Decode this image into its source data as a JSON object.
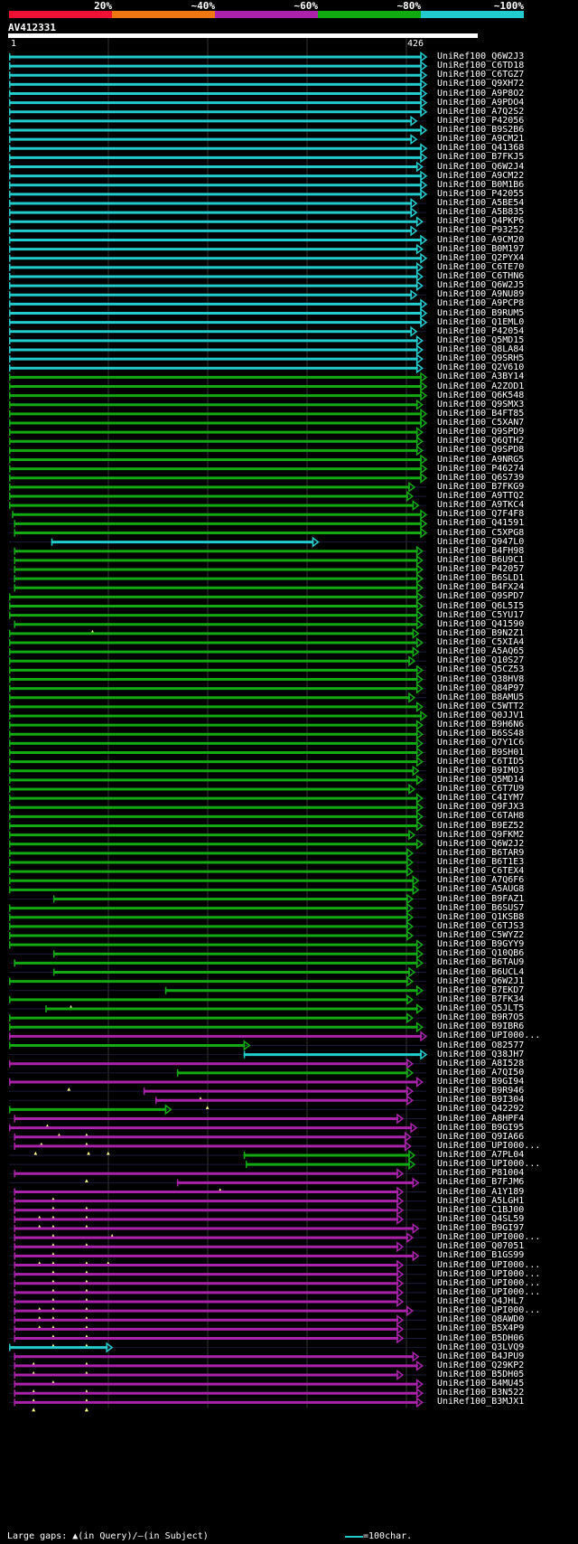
{
  "query_id": "AV412331",
  "ruler": {
    "start": "1",
    "end": "426"
  },
  "scale": {
    "labels": [
      "20%",
      "~40%",
      "~60%",
      "~80%",
      "~100%"
    ],
    "colors": [
      "#ee1133",
      "#ee7711",
      "#aa22aa",
      "#11aa11",
      "#22cccc"
    ]
  },
  "footer": {
    "gaps_text": "Large gaps: ▲(in Query)/—(in Subject)",
    "scale_text": "=100char."
  },
  "chart_data": {
    "type": "alignment",
    "query_length": 426,
    "hits": [
      {
        "id": "UniRef100_Q6W2J3",
        "start": 1,
        "end": 426,
        "color": "#22cccc"
      },
      {
        "id": "UniRef100_C6TD18",
        "start": 1,
        "end": 426,
        "color": "#22cccc"
      },
      {
        "id": "UniRef100_C6TGZ7",
        "start": 1,
        "end": 426,
        "color": "#22cccc"
      },
      {
        "id": "UniRef100_Q9XH72",
        "start": 1,
        "end": 426,
        "color": "#22cccc"
      },
      {
        "id": "UniRef100_A9P8O2",
        "start": 1,
        "end": 426,
        "color": "#22cccc"
      },
      {
        "id": "UniRef100_A9PDO4",
        "start": 1,
        "end": 426,
        "color": "#22cccc"
      },
      {
        "id": "UniRef100_A7Q2S2",
        "start": 1,
        "end": 426,
        "color": "#22cccc"
      },
      {
        "id": "UniRef100_P42056",
        "start": 1,
        "end": 416,
        "color": "#22cccc"
      },
      {
        "id": "UniRef100_B9S2B6",
        "start": 1,
        "end": 426,
        "color": "#22cccc"
      },
      {
        "id": "UniRef100_A9CM21",
        "start": 1,
        "end": 416,
        "color": "#22cccc"
      },
      {
        "id": "UniRef100_Q41368",
        "start": 1,
        "end": 426,
        "color": "#22cccc"
      },
      {
        "id": "UniRef100_B7FKJ5",
        "start": 1,
        "end": 426,
        "color": "#22cccc"
      },
      {
        "id": "UniRef100_Q6W2J4",
        "start": 1,
        "end": 422,
        "color": "#22cccc"
      },
      {
        "id": "UniRef100_A9CM22",
        "start": 1,
        "end": 426,
        "color": "#22cccc"
      },
      {
        "id": "UniRef100_B0M1B6",
        "start": 1,
        "end": 426,
        "color": "#22cccc"
      },
      {
        "id": "UniRef100_P42055",
        "start": 1,
        "end": 426,
        "color": "#22cccc"
      },
      {
        "id": "UniRef100_A5BE54",
        "start": 1,
        "end": 416,
        "color": "#22cccc"
      },
      {
        "id": "UniRef100_A5B835",
        "start": 1,
        "end": 416,
        "color": "#22cccc"
      },
      {
        "id": "UniRef100_Q4PKP6",
        "start": 1,
        "end": 422,
        "color": "#22cccc"
      },
      {
        "id": "UniRef100_P93252",
        "start": 1,
        "end": 416,
        "color": "#22cccc"
      },
      {
        "id": "UniRef100_A9CM20",
        "start": 1,
        "end": 426,
        "color": "#22cccc"
      },
      {
        "id": "UniRef100_B0M197",
        "start": 1,
        "end": 422,
        "color": "#22cccc"
      },
      {
        "id": "UniRef100_Q2PYX4",
        "start": 1,
        "end": 426,
        "color": "#22cccc"
      },
      {
        "id": "UniRef100_C6TE70",
        "start": 1,
        "end": 422,
        "color": "#22cccc"
      },
      {
        "id": "UniRef100_C6THN6",
        "start": 1,
        "end": 422,
        "color": "#22cccc"
      },
      {
        "id": "UniRef100_Q6W2J5",
        "start": 1,
        "end": 422,
        "color": "#22cccc"
      },
      {
        "id": "UniRef100_A9NU89",
        "start": 1,
        "end": 416,
        "color": "#22cccc"
      },
      {
        "id": "UniRef100_A9PCP8",
        "start": 1,
        "end": 426,
        "color": "#22cccc"
      },
      {
        "id": "UniRef100_B9RUM5",
        "start": 1,
        "end": 426,
        "color": "#22cccc"
      },
      {
        "id": "UniRef100_Q1EML0",
        "start": 1,
        "end": 426,
        "color": "#22cccc"
      },
      {
        "id": "UniRef100_P42054",
        "start": 1,
        "end": 416,
        "color": "#22cccc"
      },
      {
        "id": "UniRef100_Q5MD15",
        "start": 1,
        "end": 422,
        "color": "#22cccc"
      },
      {
        "id": "UniRef100_Q8LA84",
        "start": 1,
        "end": 422,
        "color": "#22cccc"
      },
      {
        "id": "UniRef100_Q9SRH5",
        "start": 1,
        "end": 422,
        "color": "#22cccc"
      },
      {
        "id": "UniRef100_Q2V610",
        "start": 1,
        "end": 422,
        "color": "#22cccc"
      },
      {
        "id": "UniRef100_A3BY14",
        "start": 1,
        "end": 426,
        "color": "#11aa11"
      },
      {
        "id": "UniRef100_A2ZOD1",
        "start": 1,
        "end": 426,
        "color": "#11aa11"
      },
      {
        "id": "UniRef100_Q6K548",
        "start": 1,
        "end": 426,
        "color": "#11aa11"
      },
      {
        "id": "UniRef100_Q9SMX3",
        "start": 1,
        "end": 422,
        "color": "#11aa11"
      },
      {
        "id": "UniRef100_B4FT85",
        "start": 1,
        "end": 426,
        "color": "#11aa11"
      },
      {
        "id": "UniRef100_C5XAN7",
        "start": 1,
        "end": 426,
        "color": "#11aa11"
      },
      {
        "id": "UniRef100_Q9SPD9",
        "start": 1,
        "end": 422,
        "color": "#11aa11"
      },
      {
        "id": "UniRef100_Q6QTH2",
        "start": 1,
        "end": 422,
        "color": "#11aa11"
      },
      {
        "id": "UniRef100_Q9SPD8",
        "start": 1,
        "end": 422,
        "color": "#11aa11"
      },
      {
        "id": "UniRef100_A9NRG5",
        "start": 1,
        "end": 426,
        "color": "#11aa11"
      },
      {
        "id": "UniRef100_P46274",
        "start": 1,
        "end": 426,
        "color": "#11aa11"
      },
      {
        "id": "UniRef100_Q6S739",
        "start": 1,
        "end": 426,
        "color": "#11aa11"
      },
      {
        "id": "UniRef100_B7FKG9",
        "start": 1,
        "end": 414,
        "color": "#11aa11"
      },
      {
        "id": "UniRef100_A9TTQ2",
        "start": 1,
        "end": 412,
        "color": "#11aa11"
      },
      {
        "id": "UniRef100_A9TKC4",
        "start": 1,
        "end": 418,
        "color": "#11aa11"
      },
      {
        "id": "UniRef100_Q7F4F8",
        "start": 4,
        "end": 426,
        "color": "#11aa11"
      },
      {
        "id": "UniRef100_Q41591",
        "start": 6,
        "end": 426,
        "color": "#11aa11"
      },
      {
        "id": "UniRef100_C5XPG8",
        "start": 6,
        "end": 426,
        "color": "#11aa11"
      },
      {
        "id": "UniRef100_Q947L0",
        "start": 44,
        "end": 316,
        "color": "#22cccc"
      },
      {
        "id": "UniRef100_B4FH98",
        "start": 6,
        "end": 422,
        "color": "#11aa11"
      },
      {
        "id": "UniRef100_B6U9C1",
        "start": 6,
        "end": 422,
        "color": "#11aa11"
      },
      {
        "id": "UniRef100_P42057",
        "start": 6,
        "end": 422,
        "color": "#11aa11"
      },
      {
        "id": "UniRef100_B6SLD1",
        "start": 6,
        "end": 422,
        "color": "#11aa11"
      },
      {
        "id": "UniRef100_B4FX24",
        "start": 6,
        "end": 422,
        "color": "#11aa11"
      },
      {
        "id": "UniRef100_Q9SPD7",
        "start": 1,
        "end": 422,
        "color": "#11aa11"
      },
      {
        "id": "UniRef100_Q6L5I5",
        "start": 1,
        "end": 422,
        "color": "#11aa11"
      },
      {
        "id": "UniRef100_C5YU17",
        "start": 1,
        "end": 422,
        "color": "#11aa11"
      },
      {
        "id": "UniRef100_Q41590",
        "start": 6,
        "end": 422,
        "color": "#11aa11",
        "gaps": [
          86
        ]
      },
      {
        "id": "UniRef100_B9N2Z1",
        "start": 1,
        "end": 418,
        "color": "#11aa11"
      },
      {
        "id": "UniRef100_C5XIA4",
        "start": 1,
        "end": 422,
        "color": "#11aa11"
      },
      {
        "id": "UniRef100_A5AQ65",
        "start": 1,
        "end": 418,
        "color": "#11aa11"
      },
      {
        "id": "UniRef100_Q10S27",
        "start": 1,
        "end": 414,
        "color": "#11aa11"
      },
      {
        "id": "UniRef100_Q5CZ53",
        "start": 1,
        "end": 422,
        "color": "#11aa11"
      },
      {
        "id": "UniRef100_Q38HV8",
        "start": 1,
        "end": 422,
        "color": "#11aa11"
      },
      {
        "id": "UniRef100_Q84P97",
        "start": 1,
        "end": 422,
        "color": "#11aa11"
      },
      {
        "id": "UniRef100_B8AMU5",
        "start": 1,
        "end": 414,
        "color": "#11aa11"
      },
      {
        "id": "UniRef100_C5WTT2",
        "start": 1,
        "end": 422,
        "color": "#11aa11"
      },
      {
        "id": "UniRef100_Q0JJV1",
        "start": 1,
        "end": 426,
        "color": "#11aa11"
      },
      {
        "id": "UniRef100_B9H6N6",
        "start": 1,
        "end": 422,
        "color": "#11aa11"
      },
      {
        "id": "UniRef100_B6SS48",
        "start": 1,
        "end": 422,
        "color": "#11aa11"
      },
      {
        "id": "UniRef100_Q7Y1C6",
        "start": 1,
        "end": 422,
        "color": "#11aa11"
      },
      {
        "id": "UniRef100_B9SH01",
        "start": 1,
        "end": 422,
        "color": "#11aa11"
      },
      {
        "id": "UniRef100_C6TID5",
        "start": 1,
        "end": 422,
        "color": "#11aa11"
      },
      {
        "id": "UniRef100_B9IMO3",
        "start": 1,
        "end": 418,
        "color": "#11aa11"
      },
      {
        "id": "UniRef100_Q5MD14",
        "start": 1,
        "end": 422,
        "color": "#11aa11"
      },
      {
        "id": "UniRef100_C6T7U9",
        "start": 1,
        "end": 414,
        "color": "#11aa11"
      },
      {
        "id": "UniRef100_C4IYM7",
        "start": 1,
        "end": 422,
        "color": "#11aa11"
      },
      {
        "id": "UniRef100_Q9FJX3",
        "start": 1,
        "end": 422,
        "color": "#11aa11"
      },
      {
        "id": "UniRef100_C6TAH8",
        "start": 1,
        "end": 422,
        "color": "#11aa11"
      },
      {
        "id": "UniRef100_B9EZ52",
        "start": 1,
        "end": 422,
        "color": "#11aa11"
      },
      {
        "id": "UniRef100_Q9FKM2",
        "start": 1,
        "end": 414,
        "color": "#11aa11"
      },
      {
        "id": "UniRef100_Q6W2J2",
        "start": 1,
        "end": 422,
        "color": "#11aa11"
      },
      {
        "id": "UniRef100_B6TAR9",
        "start": 1,
        "end": 412,
        "color": "#11aa11"
      },
      {
        "id": "UniRef100_B6T1E3",
        "start": 1,
        "end": 412,
        "color": "#11aa11"
      },
      {
        "id": "UniRef100_C6TEX4",
        "start": 1,
        "end": 412,
        "color": "#11aa11"
      },
      {
        "id": "UniRef100_A7Q6F6",
        "start": 1,
        "end": 418,
        "color": "#11aa11"
      },
      {
        "id": "UniRef100_A5AUG8",
        "start": 1,
        "end": 418,
        "color": "#11aa11"
      },
      {
        "id": "UniRef100_B9FAZ1",
        "start": 46,
        "end": 412,
        "color": "#11aa11"
      },
      {
        "id": "UniRef100_B6SUS7",
        "start": 1,
        "end": 412,
        "color": "#11aa11"
      },
      {
        "id": "UniRef100_Q1KSB8",
        "start": 1,
        "end": 412,
        "color": "#11aa11"
      },
      {
        "id": "UniRef100_C6TJS3",
        "start": 1,
        "end": 412,
        "color": "#11aa11"
      },
      {
        "id": "UniRef100_C5WYZ2",
        "start": 1,
        "end": 412,
        "color": "#11aa11"
      },
      {
        "id": "UniRef100_B9GYY9",
        "start": 1,
        "end": 422,
        "color": "#11aa11"
      },
      {
        "id": "UniRef100_Q10QB6",
        "start": 46,
        "end": 422,
        "color": "#11aa11"
      },
      {
        "id": "UniRef100_B6TAU9",
        "start": 6,
        "end": 422,
        "color": "#11aa11"
      },
      {
        "id": "UniRef100_B6UCL4",
        "start": 46,
        "end": 414,
        "color": "#11aa11"
      },
      {
        "id": "UniRef100_Q6W2J1",
        "start": 1,
        "end": 412,
        "color": "#11aa11"
      },
      {
        "id": "UniRef100_B7EKD7",
        "start": 160,
        "end": 422,
        "color": "#11aa11"
      },
      {
        "id": "UniRef100_B7FK34",
        "start": 1,
        "end": 412,
        "color": "#11aa11",
        "gaps": [
          64
        ]
      },
      {
        "id": "UniRef100_Q5JLT5",
        "start": 38,
        "end": 422,
        "color": "#11aa11"
      },
      {
        "id": "UniRef100_B9R7O5",
        "start": 1,
        "end": 412,
        "color": "#11aa11"
      },
      {
        "id": "UniRef100_B9IBR6",
        "start": 1,
        "end": 422,
        "color": "#11aa11"
      },
      {
        "id": "UniRef100_UPI000...",
        "start": 1,
        "end": 426,
        "color": "#aa22aa"
      },
      {
        "id": "UniRef100_O82577",
        "start": 1,
        "end": 246,
        "color": "#11aa11"
      },
      {
        "id": "UniRef100_Q38JH7",
        "start": 240,
        "end": 426,
        "color": "#22cccc"
      },
      {
        "id": "UniRef100_A8I528",
        "start": 1,
        "end": 412,
        "color": "#aa22aa"
      },
      {
        "id": "UniRef100_A7QI50",
        "start": 172,
        "end": 412,
        "color": "#11aa11"
      },
      {
        "id": "UniRef100_B9GI94",
        "start": 1,
        "end": 422,
        "color": "#aa22aa",
        "gaps": [
          62
        ]
      },
      {
        "id": "UniRef100_B9R946",
        "start": 138,
        "end": 412,
        "color": "#aa22aa",
        "gaps": [
          196
        ]
      },
      {
        "id": "UniRef100_B9I304",
        "start": 150,
        "end": 412,
        "color": "#aa22aa",
        "gaps": [
          203
        ]
      },
      {
        "id": "UniRef100_Q42292",
        "start": 1,
        "end": 166,
        "color": "#11aa11"
      },
      {
        "id": "UniRef100_A8HPF4",
        "start": 6,
        "end": 402,
        "color": "#aa22aa",
        "gaps": [
          40
        ]
      },
      {
        "id": "UniRef100_B9GI95",
        "start": 1,
        "end": 416,
        "color": "#aa22aa",
        "gaps": [
          52,
          80
        ]
      },
      {
        "id": "UniRef100_Q9IA66",
        "start": 6,
        "end": 410,
        "color": "#aa22aa",
        "gaps": [
          34,
          80
        ]
      },
      {
        "id": "UniRef100_UPI000...",
        "start": 6,
        "end": 410,
        "color": "#aa22aa",
        "gaps": [
          28,
          82,
          102
        ]
      },
      {
        "id": "UniRef100_A7PL04",
        "start": 240,
        "end": 414,
        "color": "#11aa11"
      },
      {
        "id": "UniRef100_UPI000...",
        "start": 242,
        "end": 414,
        "color": "#11aa11"
      },
      {
        "id": "UniRef100_P81004",
        "start": 6,
        "end": 402,
        "color": "#aa22aa",
        "gaps": [
          80
        ]
      },
      {
        "id": "UniRef100_B7FJM6",
        "start": 172,
        "end": 418,
        "color": "#aa22aa",
        "gaps": [
          216
        ]
      },
      {
        "id": "UniRef100_A1Y189",
        "start": 6,
        "end": 402,
        "color": "#aa22aa",
        "gaps": [
          46
        ]
      },
      {
        "id": "UniRef100_A5LGH1",
        "start": 6,
        "end": 402,
        "color": "#aa22aa",
        "gaps": [
          46,
          80
        ]
      },
      {
        "id": "UniRef100_C1BJ00",
        "start": 6,
        "end": 402,
        "color": "#aa22aa",
        "gaps": [
          32,
          46,
          80
        ]
      },
      {
        "id": "UniRef100_Q4SL59",
        "start": 6,
        "end": 402,
        "color": "#aa22aa",
        "gaps": [
          32,
          46,
          80
        ]
      },
      {
        "id": "UniRef100_B9GI97",
        "start": 6,
        "end": 418,
        "color": "#aa22aa",
        "gaps": [
          46,
          106
        ]
      },
      {
        "id": "UniRef100_UPI000...",
        "start": 6,
        "end": 412,
        "color": "#aa22aa",
        "gaps": [
          46,
          80
        ]
      },
      {
        "id": "UniRef100_Q07051",
        "start": 6,
        "end": 402,
        "color": "#aa22aa",
        "gaps": [
          46
        ]
      },
      {
        "id": "UniRef100_B1GS99",
        "start": 6,
        "end": 418,
        "color": "#aa22aa",
        "gaps": [
          32,
          46,
          80,
          102
        ]
      },
      {
        "id": "UniRef100_UPI000...",
        "start": 6,
        "end": 402,
        "color": "#aa22aa",
        "gaps": [
          46,
          80
        ]
      },
      {
        "id": "UniRef100_UPI000...",
        "start": 6,
        "end": 402,
        "color": "#aa22aa",
        "gaps": [
          46,
          80
        ]
      },
      {
        "id": "UniRef100_UPI000...",
        "start": 6,
        "end": 402,
        "color": "#aa22aa",
        "gaps": [
          46,
          80
        ]
      },
      {
        "id": "UniRef100_UPI000...",
        "start": 6,
        "end": 402,
        "color": "#aa22aa",
        "gaps": [
          46,
          80
        ]
      },
      {
        "id": "UniRef100_Q4JHL7",
        "start": 6,
        "end": 402,
        "color": "#aa22aa",
        "gaps": [
          32,
          46,
          80
        ]
      },
      {
        "id": "UniRef100_UPI000...",
        "start": 6,
        "end": 412,
        "color": "#aa22aa",
        "gaps": [
          32,
          46,
          80
        ]
      },
      {
        "id": "UniRef100_Q8AWD0",
        "start": 6,
        "end": 402,
        "color": "#aa22aa",
        "gaps": [
          32,
          46,
          80
        ]
      },
      {
        "id": "UniRef100_B5X4P9",
        "start": 6,
        "end": 402,
        "color": "#aa22aa",
        "gaps": [
          46,
          80
        ]
      },
      {
        "id": "UniRef100_B5DH06",
        "start": 6,
        "end": 402,
        "color": "#aa22aa",
        "gaps": [
          46,
          80
        ]
      },
      {
        "id": "UniRef100_Q3LVQ9",
        "start": 1,
        "end": 106,
        "color": "#22cccc"
      },
      {
        "id": "UniRef100_B4JPU9",
        "start": 6,
        "end": 418,
        "color": "#aa22aa",
        "gaps": [
          26,
          80
        ]
      },
      {
        "id": "UniRef100_Q29KP2",
        "start": 6,
        "end": 422,
        "color": "#aa22aa",
        "gaps": [
          26,
          80
        ]
      },
      {
        "id": "UniRef100_B5DH05",
        "start": 6,
        "end": 402,
        "color": "#aa22aa",
        "gaps": [
          46
        ]
      },
      {
        "id": "UniRef100_B4MU45",
        "start": 6,
        "end": 422,
        "color": "#aa22aa",
        "gaps": [
          26,
          80
        ]
      },
      {
        "id": "UniRef100_B3N522",
        "start": 6,
        "end": 422,
        "color": "#aa22aa",
        "gaps": [
          26,
          80
        ]
      },
      {
        "id": "UniRef100_B3MJX1",
        "start": 6,
        "end": 422,
        "color": "#aa22aa",
        "gaps": [
          26,
          80
        ]
      }
    ]
  }
}
